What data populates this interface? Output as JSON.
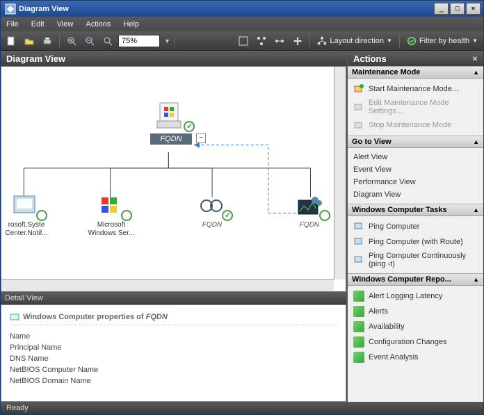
{
  "window": {
    "title": "Diagram View"
  },
  "menu": [
    "File",
    "Edit",
    "View",
    "Actions",
    "Help"
  ],
  "toolbar": {
    "zoom": "75%",
    "layout_label": "Layout direction",
    "filter_label": "Filter by health"
  },
  "diagram": {
    "title": "Diagram View",
    "root": {
      "label": "FQDN"
    },
    "children": [
      {
        "label1": "rosoft.Syste",
        "label2": "Center.Notif..."
      },
      {
        "label1": "Microsoft",
        "label2": "Windows Ser..."
      },
      {
        "label_italic": "FQDN"
      },
      {
        "label_italic": "FQDN"
      }
    ]
  },
  "detail": {
    "header": "Detail View",
    "title_prefix": "Windows Computer properties of",
    "title_subject": "FQDN",
    "properties": [
      "Name",
      "Principal Name",
      "DNS Name",
      "NetBIOS Computer Name",
      "NetBIOS Domain Name"
    ]
  },
  "actions": {
    "title": "Actions",
    "sections": {
      "maintenance": {
        "header": "Maintenance Mode",
        "items": [
          {
            "text": "Start Maintenance Mode...",
            "enabled": true
          },
          {
            "text": "Edit Maintenance Mode Settings...",
            "enabled": false
          },
          {
            "text": "Stop Maintenance Mode",
            "enabled": false
          }
        ]
      },
      "goto": {
        "header": "Go to View",
        "items": [
          "Alert View",
          "Event View",
          "Performance View",
          "Diagram View"
        ]
      },
      "tasks": {
        "header": "Windows Computer Tasks",
        "items": [
          "Ping Computer",
          "Ping Computer (with Route)",
          "Ping Computer Continuously (ping -t)"
        ]
      },
      "reports": {
        "header": "Windows Computer Repo...",
        "items": [
          "Alert Logging Latency",
          "Alerts",
          "Availability",
          "Configuration Changes",
          "Event Analysis"
        ]
      }
    }
  },
  "status": "Ready"
}
